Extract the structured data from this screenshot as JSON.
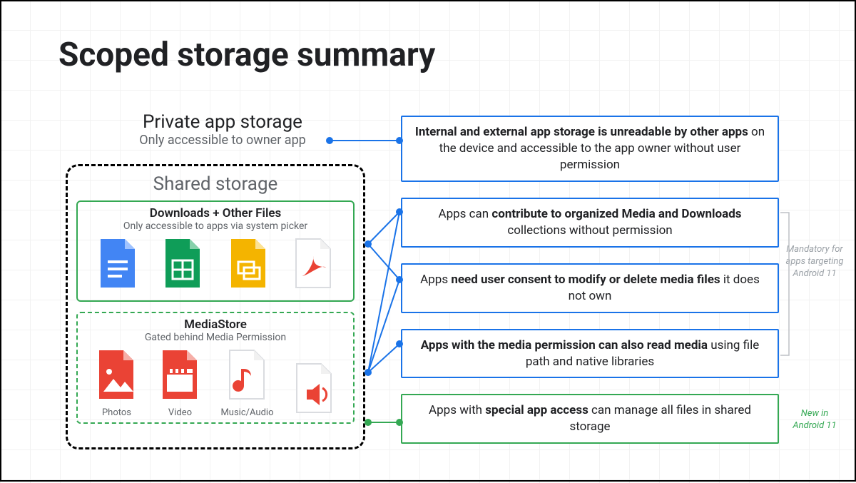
{
  "title": "Scoped storage summary",
  "private": {
    "heading": "Private app storage",
    "sub": "Only accessible to owner app"
  },
  "shared": {
    "heading": "Shared storage",
    "downloads": {
      "title": "Downloads + Other Files",
      "sub": "Only accessible to apps via system picker"
    },
    "media": {
      "title": "MediaStore",
      "sub": "Gated behind Media Permission",
      "labels": {
        "photos": "Photos",
        "video": "Video",
        "music": "Music/Audio"
      }
    }
  },
  "cards": {
    "c1a": "Internal and external app storage is unreadable by other apps",
    "c1b": " on the device and accessible to the app owner without user permission",
    "c2a": "Apps can ",
    "c2b": "contribute to organized Media and Downloads",
    "c2c": " collections without permission",
    "c3a": "Apps ",
    "c3b": "need user consent to modify or delete media files",
    "c3c": " it does not own",
    "c4a": "Apps with the media permission can also read media",
    "c4b": " using file path and native libraries",
    "c5a": "Apps with ",
    "c5b": "special app access",
    "c5c": " can manage all files in shared storage"
  },
  "annotations": {
    "mandatory": "Mandatory for apps targeting Android 11",
    "new": "New in Android 11"
  },
  "colors": {
    "blue": "#1a73e8",
    "green": "#34a853",
    "red": "#ea4335",
    "yellow": "#fbbc04"
  }
}
